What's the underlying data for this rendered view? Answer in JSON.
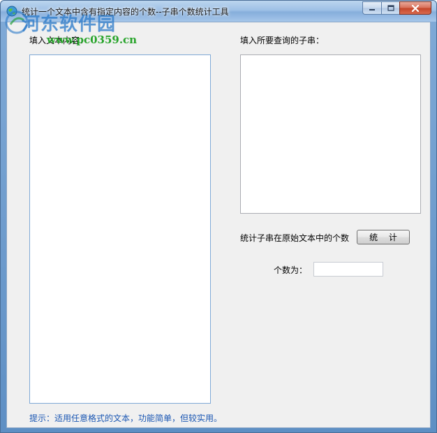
{
  "window": {
    "title": "统计一个文本中含有指定内容的个数--子串个数统计工具",
    "icon": "app-globe-icon",
    "caption_buttons": {
      "minimize_icon": "minimize-icon",
      "maximize_icon": "maximize-icon",
      "close_icon": "close-icon"
    }
  },
  "watermark": {
    "brand": "河东软件园",
    "url": "www.pc0359.cn"
  },
  "form": {
    "source_label": "填入文本内容：",
    "source_value": "",
    "substring_label": "填入所要查询的子串：",
    "substring_value": "",
    "count_prompt": "统计子串在原始文本中的个数",
    "count_button": "统 计",
    "result_label": "个数为：",
    "result_value": "",
    "hint": "提示：适用任意格式的文本，功能简单，但较实用。"
  },
  "colors": {
    "titlebar": "#9ec0e6",
    "client_bg": "#f0f0f0",
    "hint_text": "#1b57b3",
    "watermark_brand": "#2878c8",
    "watermark_url": "#27a42a",
    "close_button": "#c4452a"
  }
}
